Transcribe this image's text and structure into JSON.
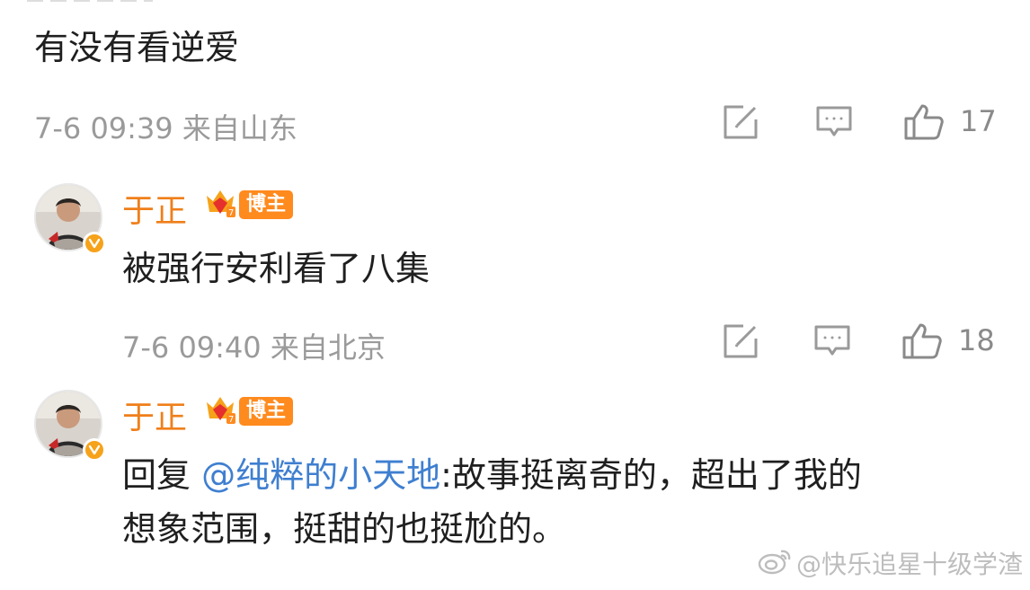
{
  "comment_1": {
    "text": "有没有看逆爱",
    "time": "7-6 09:39",
    "location": "来自山东",
    "like_count": "17"
  },
  "reply_1": {
    "username": "于正",
    "badge": "博主",
    "text": "被强行安利看了八集",
    "time": "7-6 09:40",
    "location": "来自北京",
    "like_count": "18"
  },
  "reply_2": {
    "username": "于正",
    "badge": "博主",
    "text_prefix": "回复",
    "mention": "@纯粹的小天地",
    "text_line_1": ":故事挺离奇的，超出了我的",
    "text_line_2": "想象范围，挺甜的也挺尬的。"
  },
  "watermark": {
    "text": "@快乐追星十级学渣"
  },
  "colors": {
    "username": "#ef7f1a",
    "mention": "#3f7fd0",
    "meta": "#9a9a9a",
    "badge_bg": "#ff8a1e",
    "verify_badge": "#f6a21a"
  },
  "icons": [
    "edit-icon",
    "comment-icon",
    "like-icon",
    "verified-v-icon",
    "crown-icon",
    "weibo-logo-icon"
  ]
}
